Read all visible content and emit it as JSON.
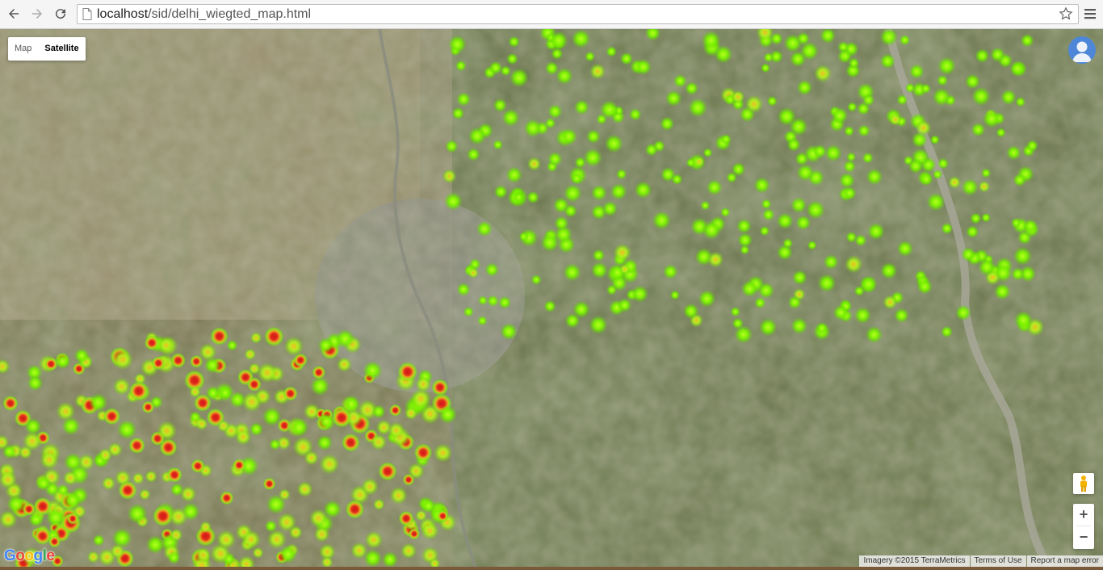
{
  "browser": {
    "url_host": "localhost",
    "url_path": "/sid/delhi_wiegted_map.html"
  },
  "map": {
    "type_controls": [
      {
        "label": "Map",
        "active": false
      },
      {
        "label": "Satellite",
        "active": true
      }
    ],
    "zoom_in_label": "+",
    "zoom_out_label": "−",
    "logo": "Google",
    "attribution": {
      "imagery": "Imagery ©2015 TerraMetrics",
      "terms": "Terms of Use",
      "report": "Report a map error"
    },
    "heatmap_layers": [
      {
        "name": "green-cluster",
        "color": "#7cfc00"
      },
      {
        "name": "red-cluster",
        "color": "#d81f1f"
      }
    ]
  }
}
